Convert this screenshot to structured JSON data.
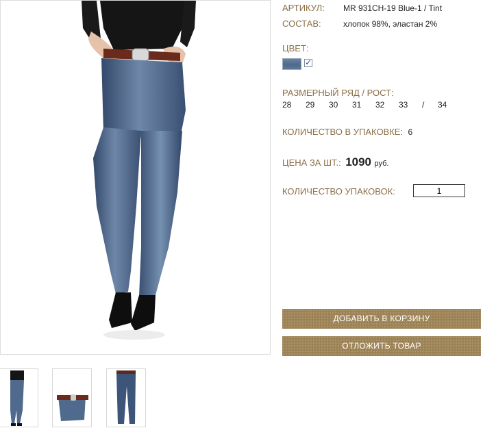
{
  "product": {
    "article_label": "АРТИКУЛ:",
    "article_value": "MR 931CH-19 Blue-1 / Tint",
    "composition_label": "СОСТАВ:",
    "composition_value": "хлопок 98%, эластан 2%",
    "color_label": "ЦВЕТ:",
    "color_check_mark": "✓",
    "size_range_label": "РАЗМЕРНЫЙ РЯД / РОСТ:",
    "sizes": [
      "28",
      "29",
      "30",
      "31",
      "32",
      "33",
      "/",
      "34"
    ],
    "pack_qty_label": "КОЛИЧЕСТВО В УПАКОВКЕ:",
    "pack_qty_value": "6",
    "price_label": "ЦЕНА ЗА ШТ.:",
    "price_value": "1090",
    "price_currency": "руб.",
    "packs_label": "КОЛИЧЕСТВО УПАКОВОК:",
    "packs_value": "1"
  },
  "actions": {
    "add_to_cart": "ДОБАВИТЬ В КОРЗИНУ",
    "postpone": "ОТЛОЖИТЬ ТОВАР"
  },
  "colors": {
    "label": "#8b6f47",
    "button": "#9c8254",
    "denim": "#4f6a8c"
  }
}
